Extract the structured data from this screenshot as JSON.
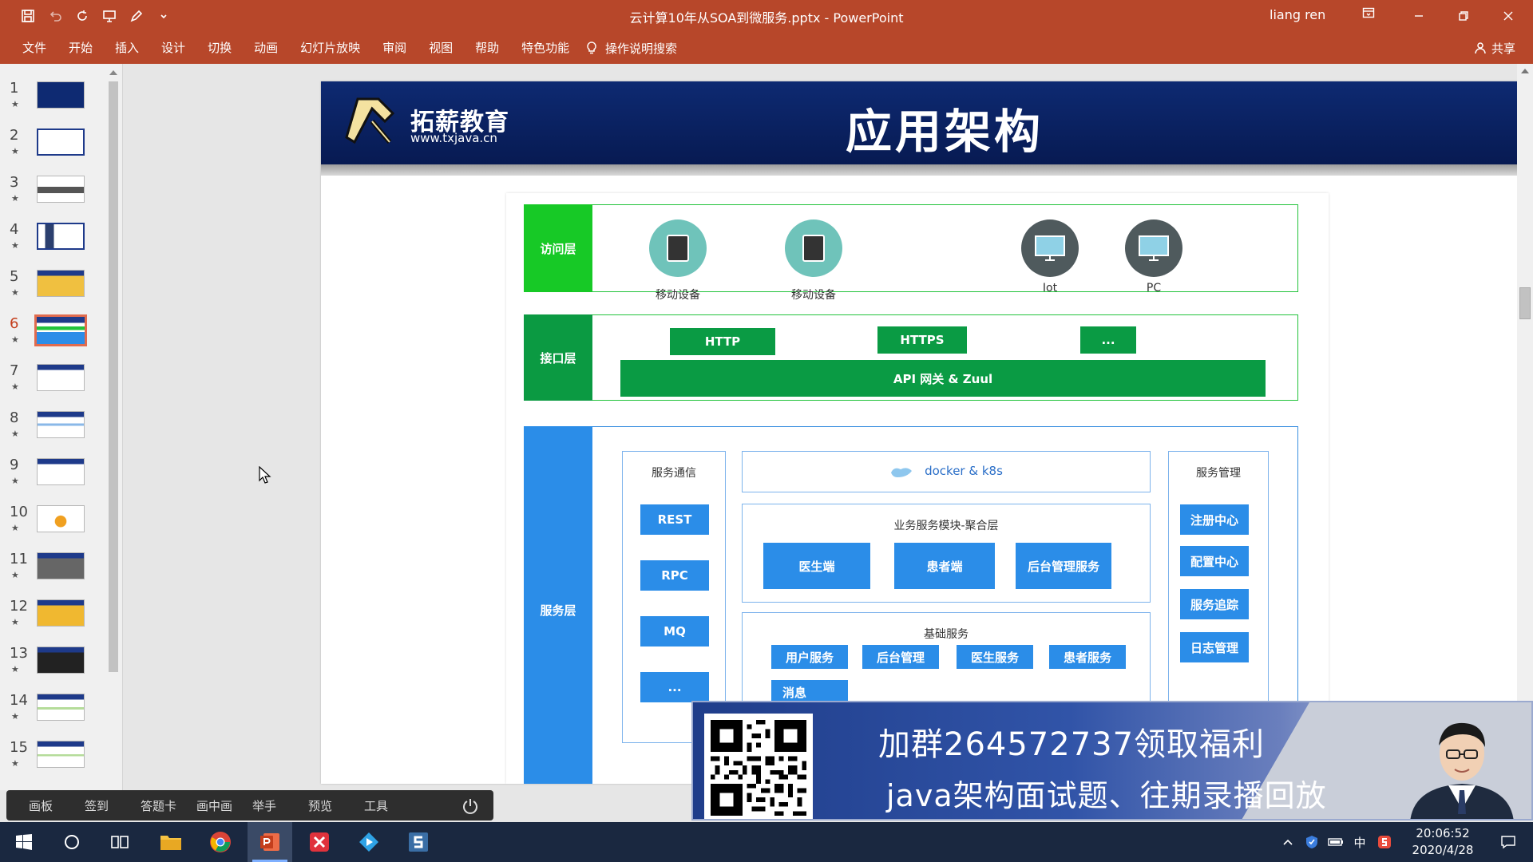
{
  "window": {
    "title": "云计算10年从SOA到微服务.pptx  -  PowerPoint",
    "user": "liang ren"
  },
  "menu": [
    "文件",
    "开始",
    "插入",
    "设计",
    "切换",
    "动画",
    "幻灯片放映",
    "审阅",
    "视图",
    "帮助",
    "特色功能"
  ],
  "tell_me": "操作说明搜索",
  "share": "共享",
  "thumbnails": [
    {
      "num": "1",
      "star": "★"
    },
    {
      "num": "2",
      "star": "★"
    },
    {
      "num": "3",
      "star": "★"
    },
    {
      "num": "4",
      "star": "★"
    },
    {
      "num": "5",
      "star": "★"
    },
    {
      "num": "6",
      "star": "★"
    },
    {
      "num": "7",
      "star": "★"
    },
    {
      "num": "8",
      "star": "★"
    },
    {
      "num": "9",
      "star": "★"
    },
    {
      "num": "10",
      "star": "★"
    },
    {
      "num": "11",
      "star": "★"
    },
    {
      "num": "12",
      "star": "★"
    },
    {
      "num": "13",
      "star": "★"
    },
    {
      "num": "14",
      "star": "★"
    },
    {
      "num": "15",
      "star": "★"
    }
  ],
  "active_slide": 6,
  "slide": {
    "logo_name": "拓薪教育",
    "logo_url": "www.txjava.cn",
    "title": "应用架构",
    "access_layer": {
      "label": "访问层",
      "devices": [
        {
          "label": "移动设备",
          "icon": "tablet-icon"
        },
        {
          "label": "移动设备",
          "icon": "tablet-icon"
        },
        {
          "label": "Iot",
          "icon": "monitor-icon"
        },
        {
          "label": "PC",
          "icon": "monitor-icon"
        }
      ]
    },
    "interface_layer": {
      "label": "接口层",
      "protocols": [
        "HTTP",
        "HTTPS",
        "..."
      ],
      "gateway": "API 网关 & Zuul"
    },
    "service_layer": {
      "label": "服务层",
      "communication": {
        "title": "服务通信",
        "items": [
          "REST",
          "RPC",
          "MQ",
          "..."
        ]
      },
      "docker": "docker & k8s",
      "business": {
        "title": "业务服务模块-聚合层",
        "items": [
          "医生端",
          "患者端",
          "后台管理服务"
        ]
      },
      "basic": {
        "title": "基础服务",
        "items": [
          "用户服务",
          "后台管理",
          "医生服务",
          "患者服务"
        ],
        "second_row": [
          "消息"
        ]
      },
      "management": {
        "title": "服务管理",
        "items": [
          "注册中心",
          "配置中心",
          "服务追踪",
          "日志管理"
        ]
      }
    }
  },
  "floatbar": [
    "画板",
    "签到",
    "答题卡",
    "画中画",
    "举手",
    "预览",
    "工具"
  ],
  "promo": {
    "line1": "加群264572737领取福利",
    "line2": "java架构面试题、往期录播回放"
  },
  "tray": {
    "ime": "中",
    "time": "20:06:52",
    "date": "2020/4/28"
  },
  "colors": {
    "ribbon": "#b7472a",
    "access_green": "#17c926",
    "interface_green": "#0b9a42",
    "service_blue": "#2b8de8",
    "header_navy": "#0e2a72"
  }
}
